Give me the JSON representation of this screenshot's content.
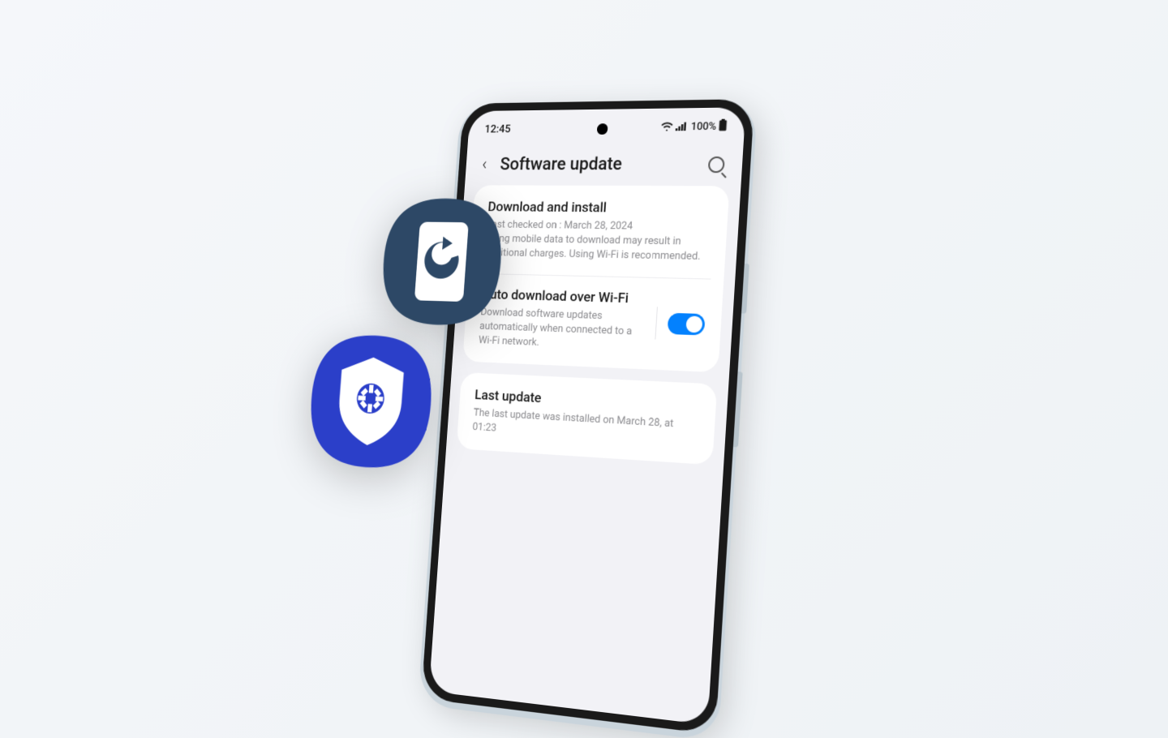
{
  "statusBar": {
    "time": "12:45",
    "batteryText": "100%"
  },
  "header": {
    "title": "Software update"
  },
  "items": {
    "download": {
      "title": "Download and install",
      "line1": "Last checked on : March 28, 2024",
      "line2": "Using mobile data to download may result in additional charges. Using Wi-Fi is recommended."
    },
    "autoDownload": {
      "title": "Auto download over Wi-Fi",
      "sub": "Download software updates automatically when connected to a Wi-Fi network.",
      "toggle": true
    },
    "lastUpdate": {
      "title": "Last update",
      "sub": "The last update was installed on March 28, at 01:23"
    }
  }
}
